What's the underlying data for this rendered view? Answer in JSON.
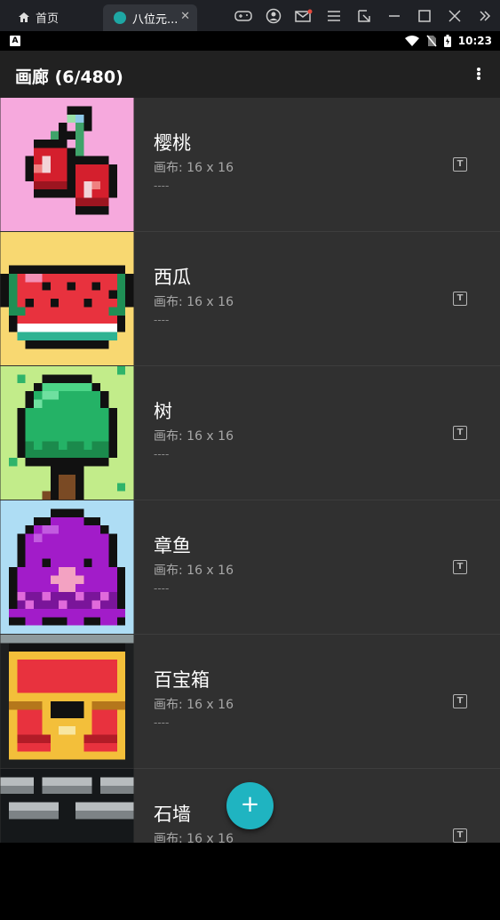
{
  "window": {
    "home_tab_label": "首页",
    "app_tab_label": "八位元...",
    "controls": [
      "gamepad-icon",
      "user-icon",
      "mail-icon",
      "menu-icon",
      "resize-icon",
      "minimize-icon",
      "maximize-icon",
      "close-icon",
      "more-icon"
    ]
  },
  "status": {
    "indicator": "A",
    "time": "10:23"
  },
  "appbar": {
    "title": "画廊 (6/480)"
  },
  "gallery": {
    "items": [
      {
        "name": "樱桃",
        "canvas": "画布: 16 x 16",
        "desc": "----"
      },
      {
        "name": "西瓜",
        "canvas": "画布: 16 x 16",
        "desc": "----"
      },
      {
        "name": "树",
        "canvas": "画布: 16 x 16",
        "desc": "----"
      },
      {
        "name": "章鱼",
        "canvas": "画布: 16 x 16",
        "desc": "----"
      },
      {
        "name": "百宝箱",
        "canvas": "画布: 16 x 16",
        "desc": "----"
      },
      {
        "name": "石墙",
        "canvas": "画布: 16 x 16",
        "desc": ""
      }
    ]
  },
  "fab": {
    "label": "+"
  },
  "colors": {
    "accent": "#1fb4c1",
    "row_bg": "#303030",
    "appbar_bg": "#212121"
  }
}
